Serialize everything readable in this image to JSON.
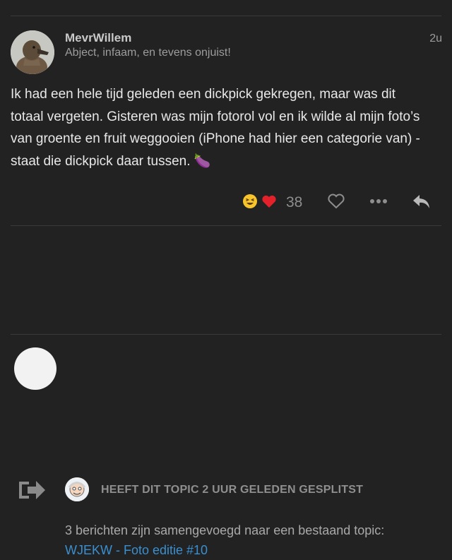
{
  "post": {
    "username": "MevrWillem",
    "user_title": "Abject, infaam, en tevens onjuist!",
    "date": "2u",
    "body": "Ik had een hele tijd geleden een dickpick gekregen, maar was dit totaal vergeten. Gisteren was mijn fotorol vol en ik wilde al mijn foto’s van groente en fruit weggooien (iPhone had hier een categorie van) - staat die dickpick daar tussen. 🍆",
    "reactions": [
      {
        "name": "laughing-face-icon",
        "emoji": "😆"
      },
      {
        "name": "red-heart-icon",
        "emoji": "❤️"
      }
    ],
    "reaction_count": "38",
    "icons": [
      "heart-outline-icon",
      "ellipsis-icon",
      "reply-icon"
    ]
  },
  "small_action": {
    "icon": "split-arrow-icon",
    "description": "HEEFT DIT TOPIC 2 UUR GELEDEN GESPLITST",
    "text": "3 berichten zijn samengevoegd naar een bestaand topic:",
    "link": "WJEKW - Foto editie #10",
    "link_color": "#3a8fd0"
  },
  "colors": {
    "background": "#222222",
    "body_text": "#e8e8e8",
    "muted_text": "#9d9d9d"
  }
}
